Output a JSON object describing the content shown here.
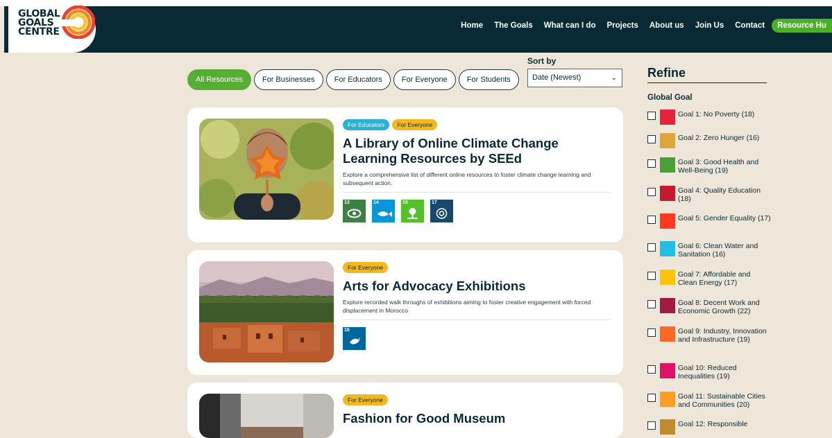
{
  "logo": {
    "line1": "GLOBAL",
    "line2": "GOALS",
    "line3": "CENTRE"
  },
  "nav": [
    "Home",
    "The Goals",
    "What can I do",
    "Projects",
    "About us",
    "Join Us",
    "Contact"
  ],
  "nav_cta": "Resource Hu",
  "filters": [
    "All Resources",
    "For Businesses",
    "For Educators",
    "For Everyone",
    "For Students"
  ],
  "sort": {
    "label": "Sort by",
    "value": "Date (Newest)"
  },
  "cards": [
    {
      "tags": [
        "For Educators",
        "For Everyone"
      ],
      "title": "A Library of Online Climate Change Learning Resources by SEEd",
      "description": "Explore a comprehensive list of different online resources to foster climate change learning and subsequent action.",
      "goals": [
        "13",
        "14",
        "15",
        "17"
      ]
    },
    {
      "tags": [
        "For Everyone"
      ],
      "title": "Arts for Advocacy Exhibitions",
      "description": "Explore recorded walk throughs of exhibitions aiming to foster creative engagement with forced displacement in Morocco",
      "goals": [
        "16"
      ]
    },
    {
      "tags": [
        "For Everyone"
      ],
      "title": "Fashion for Good Museum"
    }
  ],
  "refine": {
    "title": "Refine",
    "group_label": "Global Goal",
    "goals": [
      "Goal 1: No Poverty (18)",
      "Goal 2: Zero Hunger (16)",
      "Goal 3: Good Health and Well-Being (19)",
      "Goal 4: Quality Education (18)",
      "Goal 5: Gender Equality (17)",
      "Goal 6: Clean Water and Sanitation (16)",
      "Goal 7: Affordable and Clean Energy (17)",
      "Goal 8: Decent Work and Economic Growth (22)",
      "Goal 9: Industry, Innovation and Infrastructure (19)",
      "Goal 10: Reduced Inequalities (19)",
      "Goal 11: Sustainable Cities and Communities (20)",
      "Goal 12: Responsible"
    ]
  },
  "colors": {
    "header": "#072a35",
    "accent_green": "#56ae35",
    "tag_educators": "#2bb0d6",
    "tag_everyone": "#f3b81e",
    "page_bg": "#ede6d9"
  }
}
